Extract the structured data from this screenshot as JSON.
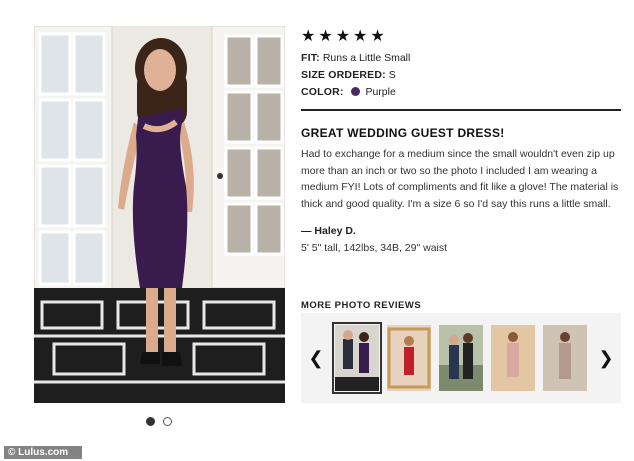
{
  "rating": {
    "stars": [
      "★",
      "★",
      "★",
      "★",
      "★"
    ],
    "value": 5
  },
  "details": {
    "fit_label": "FIT:",
    "fit_value": "Runs a Little Small",
    "size_label": "SIZE ORDERED:",
    "size_value": "S",
    "color_label": "COLOR:",
    "color_value": "Purple",
    "color_hex": "#4a2a5c"
  },
  "review": {
    "headline": "GREAT WEDDING GUEST DRESS!",
    "body": "Had to exchange for a medium since the small wouldn't even zip up more than an inch or two so the photo I included I am wearing a medium FYI! Lots of compliments and fit like a glove! The material is thick and good quality. I'm a size 6 so I'd say this runs a little small.",
    "author": "— Haley D.",
    "stats": "5' 5\" tall, 142lbs, 34B, 29\" waist"
  },
  "more_photos": {
    "label": "MORE PHOTO REVIEWS",
    "prev_icon": "chevron-left-icon",
    "next_icon": "chevron-right-icon",
    "prev_glyph": "❮",
    "next_glyph": "❯"
  },
  "watermark": "© Lulus.com"
}
